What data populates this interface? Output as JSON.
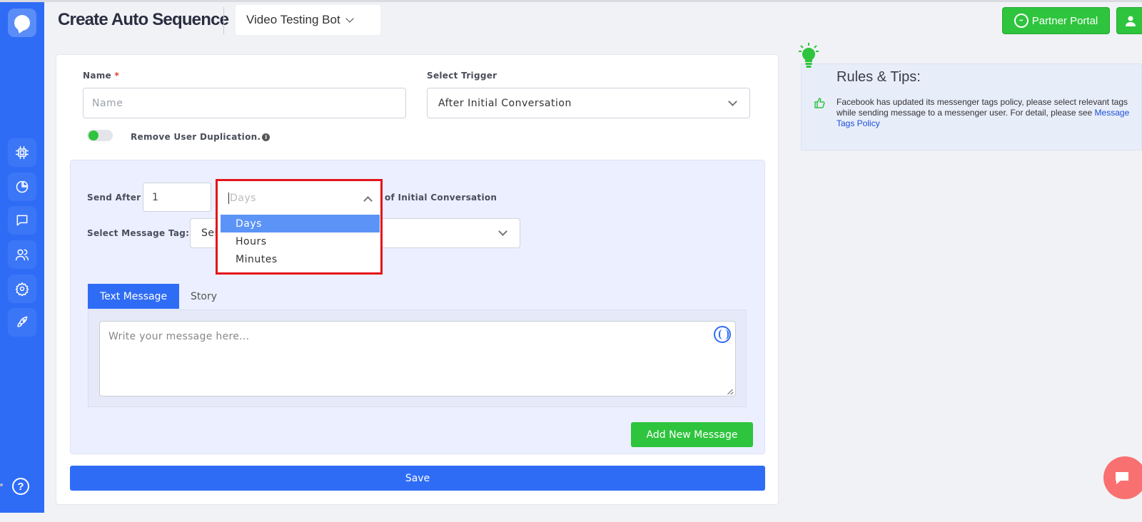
{
  "header": {
    "title": "Create Auto Sequence",
    "bot_selector": "Video Testing Bot",
    "partner_portal_label": "Partner Portal"
  },
  "sidebar": {
    "items": [
      {
        "icon": "chip-icon"
      },
      {
        "icon": "pie-chart-icon"
      },
      {
        "icon": "chat-icon"
      },
      {
        "icon": "users-icon"
      },
      {
        "icon": "gear-icon"
      },
      {
        "icon": "rocket-icon"
      }
    ],
    "help_label": "?"
  },
  "form": {
    "name_label": "Name",
    "name_required": "*",
    "name_placeholder": "Name",
    "trigger_label": "Select Trigger",
    "trigger_value": "After Initial Conversation",
    "dedupe_label": "Remove User Duplication.",
    "dedupe_info": "i",
    "send_after_label": "Send After",
    "send_after_value": "1",
    "unit_placeholder": "Days",
    "unit_options": [
      "Days",
      "Hours",
      "Minutes"
    ],
    "unit_selected": "Days",
    "after_suffix": "of Initial Conversation",
    "message_tag_label": "Select Message Tag:",
    "message_tag_value": "Sel",
    "tabs": [
      "Text Message",
      "Story"
    ],
    "message_placeholder": "Write your message here...",
    "add_message_label": "Add New Message",
    "save_label": "Save"
  },
  "rules": {
    "title": "Rules & Tips:",
    "text": "Facebook has updated its messenger tags policy, please select relevant tags while sending message to a messenger user. For detail, please see",
    "link": "Message Tags Policy"
  },
  "colors": {
    "primary": "#2f6cf6",
    "success": "#2ec43d",
    "highlight": "#e4141c",
    "fab": "#f97070"
  }
}
